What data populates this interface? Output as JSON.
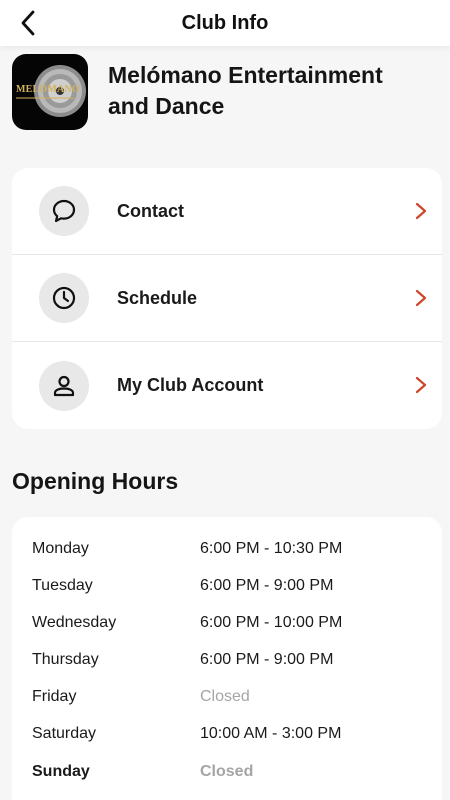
{
  "header": {
    "title": "Club Info",
    "back_icon": "chevron-left-icon"
  },
  "club": {
    "name": "Melómano Entertainment and Dance",
    "logo_text": "MELÓMANO"
  },
  "menu": {
    "items": [
      {
        "label": "Contact",
        "icon": "chat-bubble-icon"
      },
      {
        "label": "Schedule",
        "icon": "clock-icon"
      },
      {
        "label": "My Club Account",
        "icon": "person-icon"
      }
    ],
    "chevron_color": "#d0442c"
  },
  "opening_hours": {
    "title": "Opening Hours",
    "rows": [
      {
        "day": "Monday",
        "hours": "6:00 PM - 10:30 PM"
      },
      {
        "day": "Tuesday",
        "hours": "6:00 PM - 9:00 PM"
      },
      {
        "day": "Wednesday",
        "hours": "6:00 PM - 10:00 PM"
      },
      {
        "day": "Thursday",
        "hours": "6:00 PM - 9:00 PM"
      },
      {
        "day": "Friday",
        "hours": "Closed"
      },
      {
        "day": "Saturday",
        "hours": "10:00 AM - 3:00 PM"
      },
      {
        "day": "Sunday",
        "hours": "Closed"
      }
    ]
  },
  "colors": {
    "background": "#f6f6f6",
    "card": "#ffffff",
    "icon_circle": "#e8e8e8",
    "closed_text": "#a5a5a5",
    "accent": "#d0442c"
  }
}
